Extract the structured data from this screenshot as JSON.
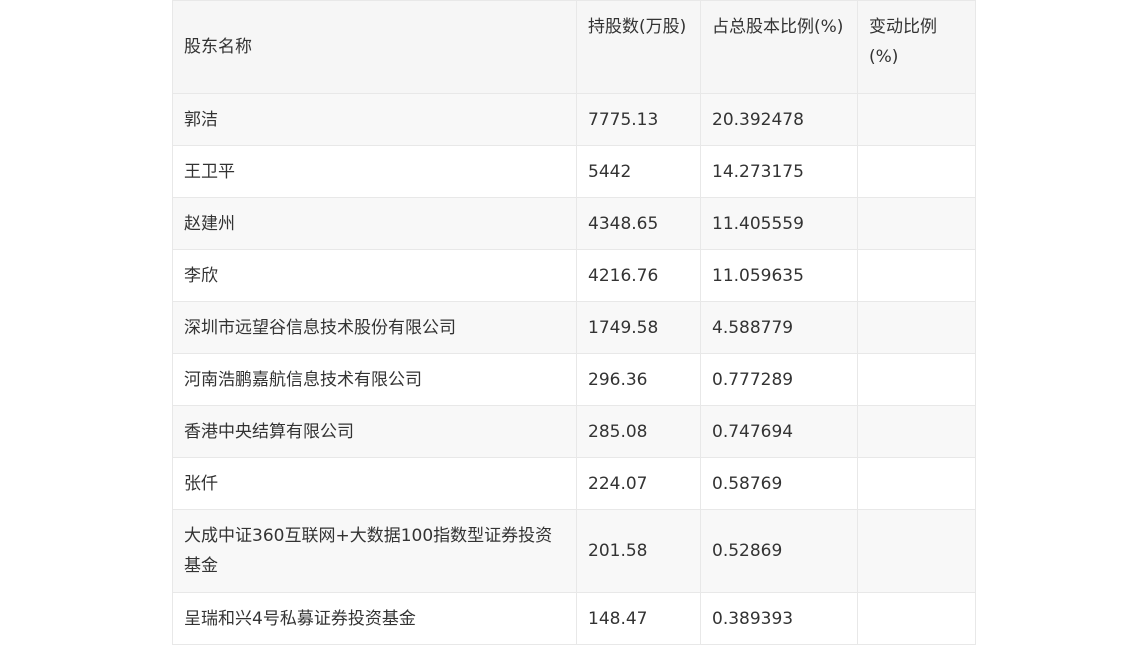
{
  "table": {
    "headers": [
      "股东名称",
      "持股数(万股)",
      "占总股本比例(%)",
      "变动比例(%)"
    ],
    "rows": [
      {
        "name": "郭洁",
        "shares": "7775.13",
        "ratio": "20.392478",
        "change": ""
      },
      {
        "name": "王卫平",
        "shares": "5442",
        "ratio": "14.273175",
        "change": ""
      },
      {
        "name": "赵建州",
        "shares": "4348.65",
        "ratio": "11.405559",
        "change": ""
      },
      {
        "name": "李欣",
        "shares": "4216.76",
        "ratio": "11.059635",
        "change": ""
      },
      {
        "name": "深圳市远望谷信息技术股份有限公司",
        "shares": "1749.58",
        "ratio": "4.588779",
        "change": ""
      },
      {
        "name": "河南浩鹏嘉航信息技术有限公司",
        "shares": "296.36",
        "ratio": "0.777289",
        "change": ""
      },
      {
        "name": "香港中央结算有限公司",
        "shares": "285.08",
        "ratio": "0.747694",
        "change": ""
      },
      {
        "name": "张仟",
        "shares": "224.07",
        "ratio": "0.58769",
        "change": ""
      },
      {
        "name": "大成中证360互联网+大数据100指数型证券投资基金",
        "shares": "201.58",
        "ratio": "0.52869",
        "change": ""
      },
      {
        "name": "呈瑞和兴4号私募证券投资基金",
        "shares": "148.47",
        "ratio": "0.389393",
        "change": ""
      }
    ]
  }
}
